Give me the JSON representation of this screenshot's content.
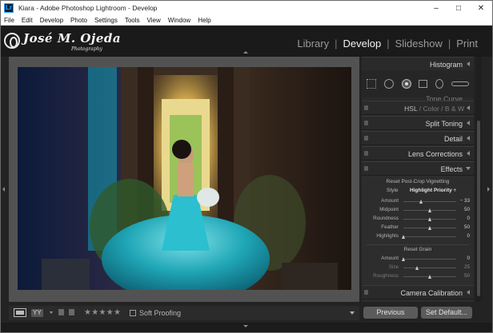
{
  "window": {
    "title": "Kiara - Adobe Photoshop Lightroom - Develop",
    "app_icon_label": "Lr",
    "controls": [
      "minimize-icon",
      "maximize-icon",
      "close-icon"
    ]
  },
  "menu": [
    "File",
    "Edit",
    "Develop",
    "Photo",
    "Settings",
    "Tools",
    "View",
    "Window",
    "Help"
  ],
  "identity_plate": {
    "name": "José M. Ojeda",
    "tagline": "Photography"
  },
  "modules": [
    {
      "label": "Library",
      "active": false
    },
    {
      "label": "Develop",
      "active": true
    },
    {
      "label": "Slideshow",
      "active": false
    },
    {
      "label": "Print",
      "active": false
    }
  ],
  "panel": {
    "histogram_label": "Histogram",
    "tone_curve_label": "Tone Curve",
    "hsl": {
      "a": "HSL",
      "sep1": " / ",
      "b": "Color",
      "sep2": " / ",
      "c": "B & W"
    },
    "split_toning_label": "Split Toning",
    "detail_label": "Detail",
    "lens_corrections_label": "Lens Corrections",
    "effects_label": "Effects",
    "camera_calibration_label": "Camera Calibration",
    "vignetting": {
      "title": "Reset Post-Crop Vignetting",
      "style_label": "Style",
      "style_value": "Highlight Priority ÷",
      "sliders": [
        {
          "label": "Amount",
          "value": "− 33",
          "level": -33,
          "min": -100,
          "max": 100
        },
        {
          "label": "Midpoint",
          "value": "50",
          "level": 50,
          "min": 0,
          "max": 100
        },
        {
          "label": "Roundness",
          "value": "0",
          "level": 0,
          "min": -100,
          "max": 100
        },
        {
          "label": "Feather",
          "value": "50",
          "level": 50,
          "min": 0,
          "max": 100
        },
        {
          "label": "Highlights",
          "value": "0",
          "level": 0,
          "min": 0,
          "max": 100
        }
      ]
    },
    "grain": {
      "title": "Reset Grain",
      "sliders": [
        {
          "label": "Amount",
          "value": "0",
          "level": 0,
          "min": 0,
          "max": 100,
          "dim": false
        },
        {
          "label": "Size",
          "value": "25",
          "level": 25,
          "min": 0,
          "max": 100,
          "dim": true
        },
        {
          "label": "Roughness",
          "value": "50",
          "level": 50,
          "min": 0,
          "max": 100,
          "dim": true
        }
      ]
    },
    "buttons": {
      "previous": "Previous",
      "set_default": "Set Default..."
    }
  },
  "toolbar": {
    "view_mode_label": "YY",
    "stars": "★★★★★",
    "soft_proofing_label": "Soft Proofing"
  },
  "colors": {
    "background": "#232323",
    "panel": "#2d2d2d",
    "photo_teal": "#1aa3b3",
    "photo_doorway_glow": "#f0d27a"
  }
}
